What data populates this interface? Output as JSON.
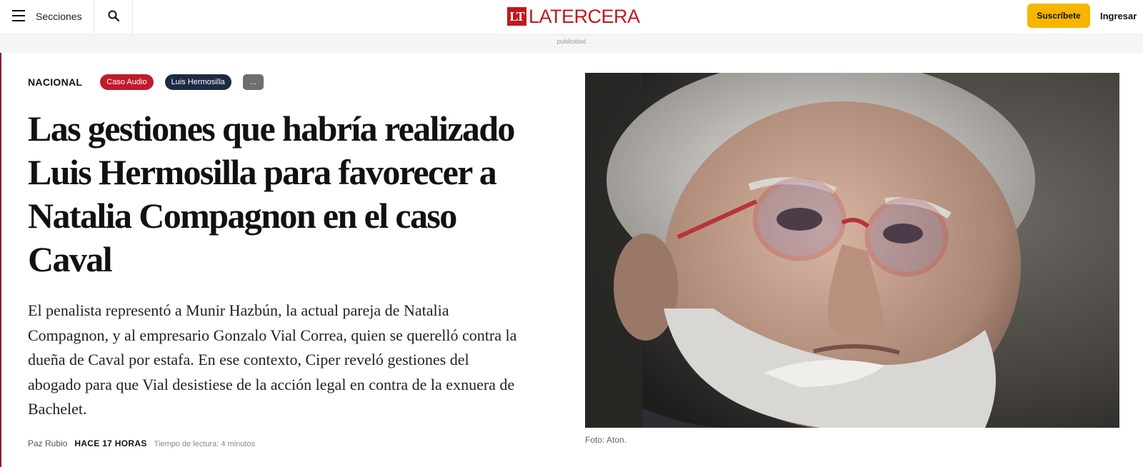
{
  "header": {
    "menu_label": "Secciones",
    "logo_mark": "LT",
    "logo_text": "LATERCERA",
    "subscribe_label": "Suscríbete",
    "login_label": "Ingresar",
    "brand_color": "#c3161c",
    "subscribe_color": "#f7b500",
    "icons": {
      "menu": "hamburger-icon",
      "search": "search-icon"
    }
  },
  "ad": {
    "label": "publicidad"
  },
  "article": {
    "section": "NACIONAL",
    "tags": [
      {
        "label": "Caso Audio",
        "color": "#c01b2d"
      },
      {
        "label": "Luis Hermosilla",
        "color": "#1c2b44"
      },
      {
        "label": "...",
        "color": "#6e6e6e"
      }
    ],
    "headline": "Las gestiones que habría realizado Luis Hermosilla para favorecer a Natalia Compagnon en el caso Caval",
    "lead": "El penalista representó a Munir Hazbún, la actual pareja de Natalia Compagnon, y al empresario Gonzalo Vial Correa, quien se querelló contra la dueña de Caval por estafa. En ese contexto, Ciper reveló gestiones del abogado para que Vial desistiese de la acción legal en contra de la exnuera de Bachelet.",
    "author": "Paz Rubio",
    "time_ago": "HACE 17 HORAS",
    "reading_time": "Tiempo de lectura: 4 minutos",
    "photo_caption": "Foto: Aton."
  }
}
